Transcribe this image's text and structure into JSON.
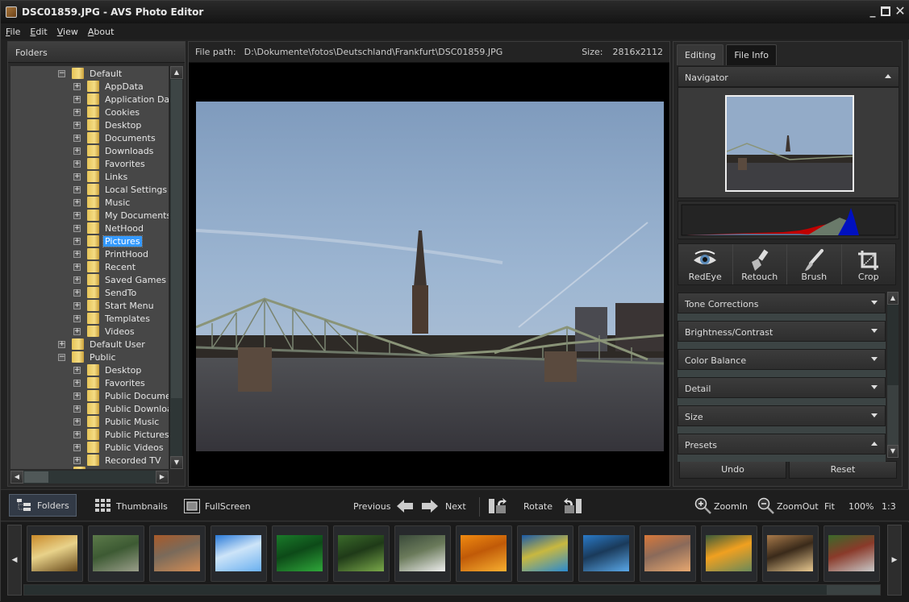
{
  "window": {
    "title": "DSC01859.JPG  -  AVS Photo Editor",
    "controls": [
      "minimize",
      "maximize",
      "close"
    ]
  },
  "menu": [
    {
      "label": "File",
      "accel": "F"
    },
    {
      "label": "Edit",
      "accel": "E"
    },
    {
      "label": "View",
      "accel": "V"
    },
    {
      "label": "About",
      "accel": "A"
    }
  ],
  "left_panel": {
    "title": "Folders",
    "tree": [
      {
        "label": "Default",
        "level": 0,
        "expanded": true
      },
      {
        "label": "AppData",
        "level": 1
      },
      {
        "label": "Application Data",
        "level": 1
      },
      {
        "label": "Cookies",
        "level": 1
      },
      {
        "label": "Desktop",
        "level": 1
      },
      {
        "label": "Documents",
        "level": 1
      },
      {
        "label": "Downloads",
        "level": 1
      },
      {
        "label": "Favorites",
        "level": 1
      },
      {
        "label": "Links",
        "level": 1
      },
      {
        "label": "Local Settings",
        "level": 1
      },
      {
        "label": "Music",
        "level": 1
      },
      {
        "label": "My Documents",
        "level": 1
      },
      {
        "label": "NetHood",
        "level": 1
      },
      {
        "label": "Pictures",
        "level": 1,
        "selected": true
      },
      {
        "label": "PrintHood",
        "level": 1
      },
      {
        "label": "Recent",
        "level": 1
      },
      {
        "label": "Saved Games",
        "level": 1
      },
      {
        "label": "SendTo",
        "level": 1
      },
      {
        "label": "Start Menu",
        "level": 1
      },
      {
        "label": "Templates",
        "level": 1
      },
      {
        "label": "Videos",
        "level": 1
      },
      {
        "label": "Default User",
        "level": 0,
        "expanded": false
      },
      {
        "label": "Public",
        "level": 0,
        "expanded": true
      },
      {
        "label": "Desktop",
        "level": 1
      },
      {
        "label": "Favorites",
        "level": 1
      },
      {
        "label": "Public Documents",
        "level": 1
      },
      {
        "label": "Public Downloads",
        "level": 1
      },
      {
        "label": "Public Music",
        "level": 1
      },
      {
        "label": "Public Pictures",
        "level": 1
      },
      {
        "label": "Public Videos",
        "level": 1
      },
      {
        "label": "Recorded TV",
        "level": 1
      }
    ]
  },
  "center": {
    "path_label": "File path:",
    "path_value": "D:\\Dokumente\\fotos\\Deutschland\\Frankfurt\\DSC01859.JPG",
    "size_label": "Size:",
    "size_value": "2816x2112",
    "image_description": "Iron footbridge over a river with a church spire, blue sky"
  },
  "right_panel": {
    "tabs": [
      {
        "label": "Editing",
        "active": true
      },
      {
        "label": "File Info",
        "active": false
      }
    ],
    "navigator_title": "Navigator",
    "tools": [
      {
        "label": "RedEye",
        "icon": "eye-icon"
      },
      {
        "label": "Retouch",
        "icon": "retouch-brush-icon"
      },
      {
        "label": "Brush",
        "icon": "paint-brush-icon"
      },
      {
        "label": "Crop",
        "icon": "crop-icon"
      }
    ],
    "sections": [
      {
        "label": "Tone Corrections",
        "state": "collapsed"
      },
      {
        "label": "Brightness/Contrast",
        "state": "collapsed"
      },
      {
        "label": "Color Balance",
        "state": "collapsed"
      },
      {
        "label": "Detail",
        "state": "collapsed"
      },
      {
        "label": "Size",
        "state": "collapsed"
      },
      {
        "label": "Presets",
        "state": "expanded"
      }
    ],
    "undo_label": "Undo",
    "reset_label": "Reset"
  },
  "toolbar": {
    "folders": "Folders",
    "thumbnails": "Thumbnails",
    "fullscreen": "FullScreen",
    "previous": "Previous",
    "next": "Next",
    "rotate": "Rotate",
    "zoom_in": "ZoomIn",
    "zoom_out": "ZoomOut",
    "fit": "Fit",
    "zoom_100": "100%",
    "ratio": "1:3"
  },
  "filmstrip": {
    "thumbnails": [
      {
        "subject": "autumn tree",
        "colors": [
          "#c98a2a",
          "#6a4b1c",
          "#e8d28a"
        ]
      },
      {
        "subject": "stream meadow",
        "colors": [
          "#5c7a4a",
          "#9a9e8a",
          "#3d5a33"
        ]
      },
      {
        "subject": "monument valley",
        "colors": [
          "#a85a2a",
          "#d28c55",
          "#7a6a5a"
        ]
      },
      {
        "subject": "glacier blue",
        "colors": [
          "#2a7ad8",
          "#6ab0f0",
          "#cde4f8"
        ]
      },
      {
        "subject": "green leaves flowers",
        "colors": [
          "#1a7a2a",
          "#2fa83a",
          "#0d4a18"
        ]
      },
      {
        "subject": "forest path",
        "colors": [
          "#3a6a2a",
          "#7aa84a",
          "#1f3a18"
        ]
      },
      {
        "subject": "white flowers",
        "colors": [
          "#3a4a3a",
          "#eeeeee",
          "#6a7a5a"
        ]
      },
      {
        "subject": "orange flowers",
        "colors": [
          "#f08a10",
          "#f8b030",
          "#c05a08"
        ]
      },
      {
        "subject": "sea turtle",
        "colors": [
          "#1a5aa8",
          "#2a8ad0",
          "#c8b840"
        ]
      },
      {
        "subject": "whale tail",
        "colors": [
          "#2a7ac8",
          "#5aa8e8",
          "#1a3a5a"
        ]
      },
      {
        "subject": "desert dunes",
        "colors": [
          "#d8783a",
          "#e8a870",
          "#8a6a5a"
        ]
      },
      {
        "subject": "toucan",
        "colors": [
          "#3a5a3a",
          "#6a8a5a",
          "#f0a020"
        ]
      },
      {
        "subject": "trees sunset",
        "colors": [
          "#a87a4a",
          "#e8c890",
          "#3a2a1a"
        ]
      },
      {
        "subject": "waterfall garden",
        "colors": [
          "#3a6a2a",
          "#c8c8c8",
          "#8a3a2a"
        ]
      }
    ]
  }
}
